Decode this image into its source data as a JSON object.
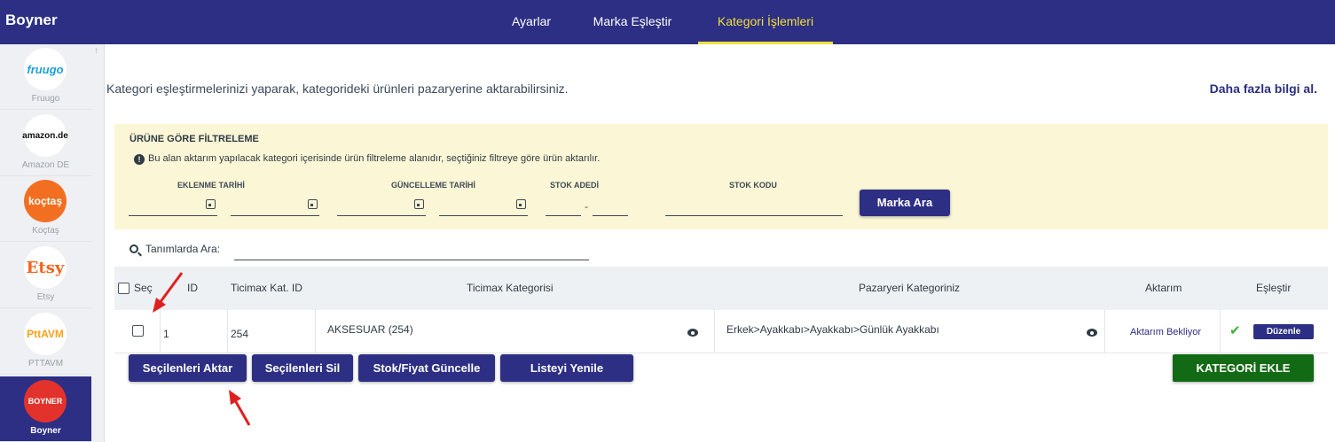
{
  "app": {
    "brand": "Boyner"
  },
  "topnav": [
    {
      "label": "Ayarlar",
      "active": false
    },
    {
      "label": "Marka Eşleştir",
      "active": false
    },
    {
      "label": "Kategori İşlemleri",
      "active": true
    }
  ],
  "sidebar": {
    "items": [
      {
        "logo": "fruugo",
        "label": "Fruugo"
      },
      {
        "logo": "amazon.de",
        "label": "Amazon DE"
      },
      {
        "logo": "koçtaş",
        "label": "Koçtaş"
      },
      {
        "logo": "Etsy",
        "label": "Etsy"
      },
      {
        "logo": "PttAVM",
        "label": "PTTAVM"
      },
      {
        "logo": "BOYNER",
        "label": "Boyner",
        "active": true
      }
    ]
  },
  "intro": {
    "text": "Kategori eşleştirmelerinizi yaparak, kategorideki ürünleri pazaryerine aktarabilirsiniz.",
    "more_link": "Daha fazla bilgi al."
  },
  "filter": {
    "title": "ÜRÜNE GÖRE FİLTRELEME",
    "note": "Bu alan aktarım yapılacak kategori içerisinde ürün filtreleme alanıdır, seçtiğiniz filtreye göre ürün aktarılır.",
    "labels": {
      "added_date": "EKLENME TARİHİ",
      "updated_date": "GÜNCELLEME TARİHİ",
      "stock_count": "STOK ADEDİ",
      "stock_code": "STOK KODU"
    },
    "range_separator": "-",
    "search_brand_button": "Marka Ara"
  },
  "search": {
    "label": "Tanımlarda Ara:"
  },
  "table": {
    "headers": {
      "select": "Seç",
      "id": "ID",
      "ticimax_cat_id": "Ticimax Kat. ID",
      "ticimax_category": "Ticimax Kategorisi",
      "marketplace_category": "Pazaryeri Kategoriniz",
      "transfer": "Aktarım",
      "match": "Eşleştir"
    },
    "rows": [
      {
        "id": "1",
        "ticimax_cat_id": "254",
        "ticimax_category": "AKSESUAR (254)",
        "marketplace_category": "Erkek>Ayakkabı>Ayakkabı>Günlük Ayakkabı",
        "transfer_status": "Aktarım Bekliyor",
        "edit_label": "Düzenle"
      }
    ]
  },
  "actions": {
    "transfer_selected": "Seçilenleri Aktar",
    "delete_selected": "Seçilenleri Sil",
    "update_stock_price": "Stok/Fiyat Güncelle",
    "refresh_list": "Listeyi Yenile",
    "add_category": "KATEGORİ EKLE"
  },
  "colors": {
    "navy": "#2c2f83",
    "active_nav": "#f2df3a",
    "filter_bg": "#fbf6d5",
    "green_button": "#136a14",
    "annotation_arrow": "#e02020"
  }
}
